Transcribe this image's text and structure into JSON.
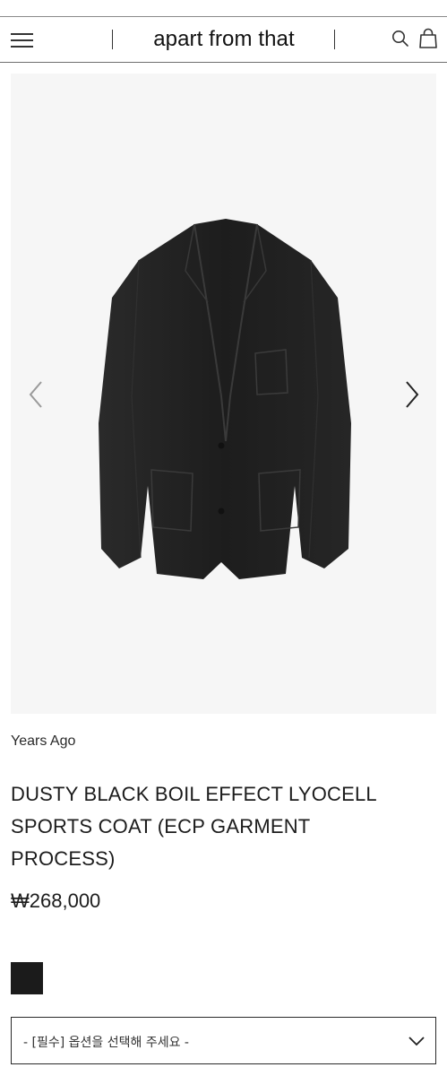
{
  "header": {
    "brand": "apart from that",
    "menu_icon": "hamburger-menu-icon",
    "search_icon": "search-icon",
    "cart_icon": "shopping-bag-icon"
  },
  "gallery": {
    "prev_icon": "chevron-left-icon",
    "next_icon": "chevron-right-icon",
    "image": "black-sports-coat-photo"
  },
  "product": {
    "brand": "Years Ago",
    "title_lines": [
      "DUSTY BLACK BOIL EFFECT LYOCELL",
      "SPORTS COAT (ECP GARMENT",
      "PROCESS)"
    ],
    "price": "₩268,000",
    "swatch_color": "#1b1b1b"
  },
  "option": {
    "placeholder": "- [필수] 옵션을 선택해 주세요 -",
    "icon": "chevron-down-icon"
  }
}
